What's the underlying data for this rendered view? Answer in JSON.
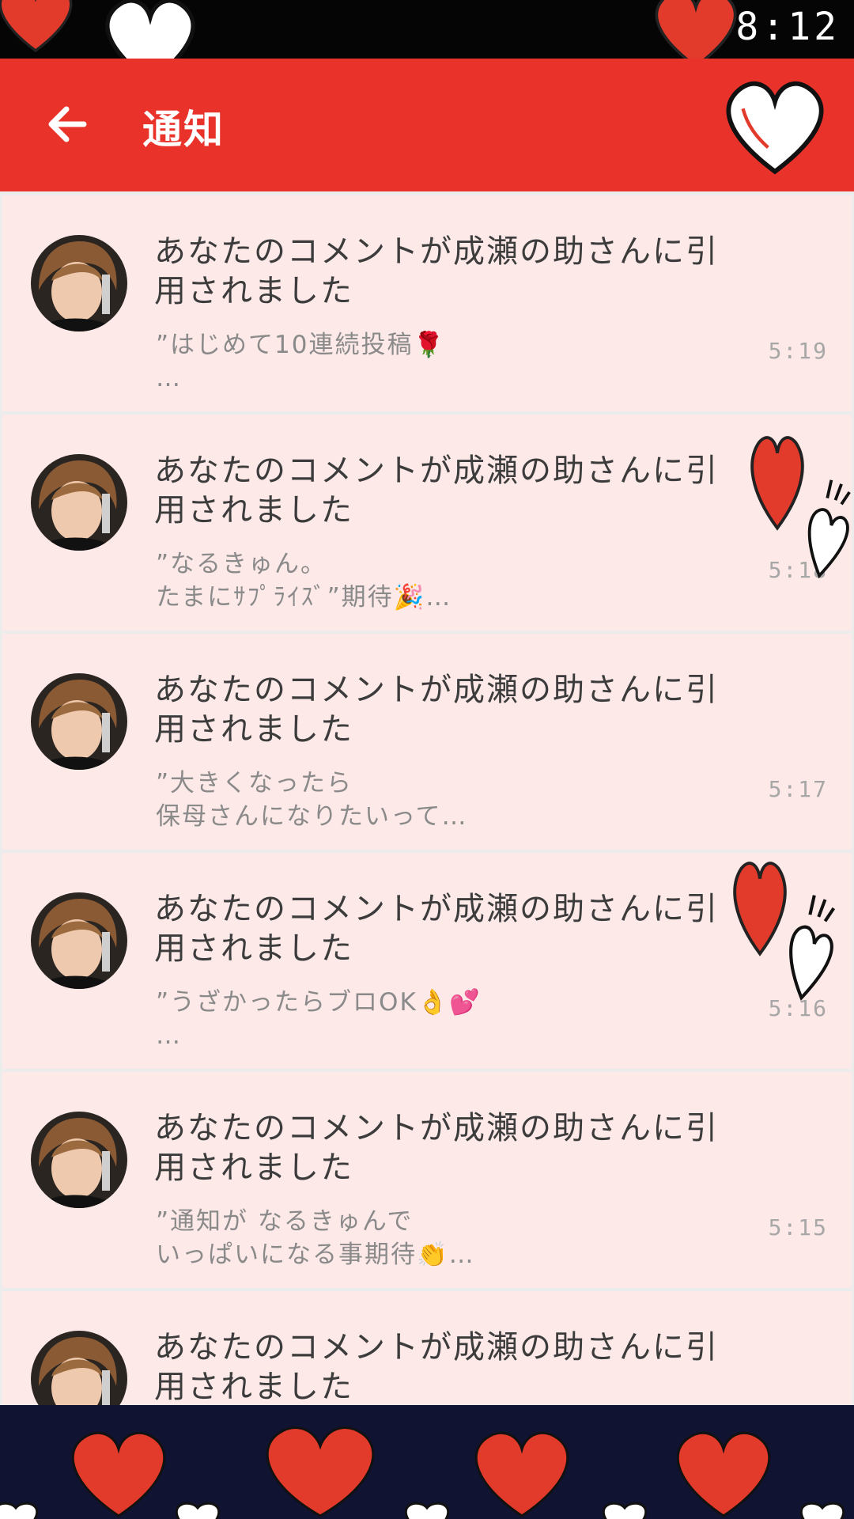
{
  "status_bar": {
    "time": "8:12"
  },
  "app_bar": {
    "back_icon": "arrow-left-icon",
    "title": "通知"
  },
  "colors": {
    "app_bar": "#e8322a",
    "status_bar": "#050505",
    "card_background": "#fde9e8",
    "title_text": "#3c3c3c",
    "excerpt_text": "#8a8a8a",
    "time_text": "#a7a7a7",
    "bottom_banner": "#101331",
    "heart_red": "#e23a2b"
  },
  "notifications": [
    {
      "title": "あなたのコメントが成瀬の助さんに引用されました",
      "excerpt_lines": [
        "”はじめて10連続投稿🌹",
        "…"
      ],
      "time": "5:19"
    },
    {
      "title": "あなたのコメントが成瀬の助さんに引用されました",
      "excerpt_lines": [
        "”なるきゅん。",
        "たまにｻﾌﾟﾗｲｽﾞ”期待🎉…"
      ],
      "time": "5:18"
    },
    {
      "title": "あなたのコメントが成瀬の助さんに引用されました",
      "excerpt_lines": [
        "”大きくなったら",
        "保母さんになりたいって…"
      ],
      "time": "5:17"
    },
    {
      "title": "あなたのコメントが成瀬の助さんに引用されました",
      "excerpt_lines": [
        "”うざかったらブロOK👌💕",
        "…"
      ],
      "time": "5:16"
    },
    {
      "title": "あなたのコメントが成瀬の助さんに引用されました",
      "excerpt_lines": [
        "”通知が なるきゅんで",
        "いっぱいになる事期待👏…"
      ],
      "time": "5:15"
    },
    {
      "title": "あなたのコメントが成瀬の助さんに引用されました",
      "excerpt_lines": [
        "",
        ""
      ],
      "time": ""
    }
  ]
}
